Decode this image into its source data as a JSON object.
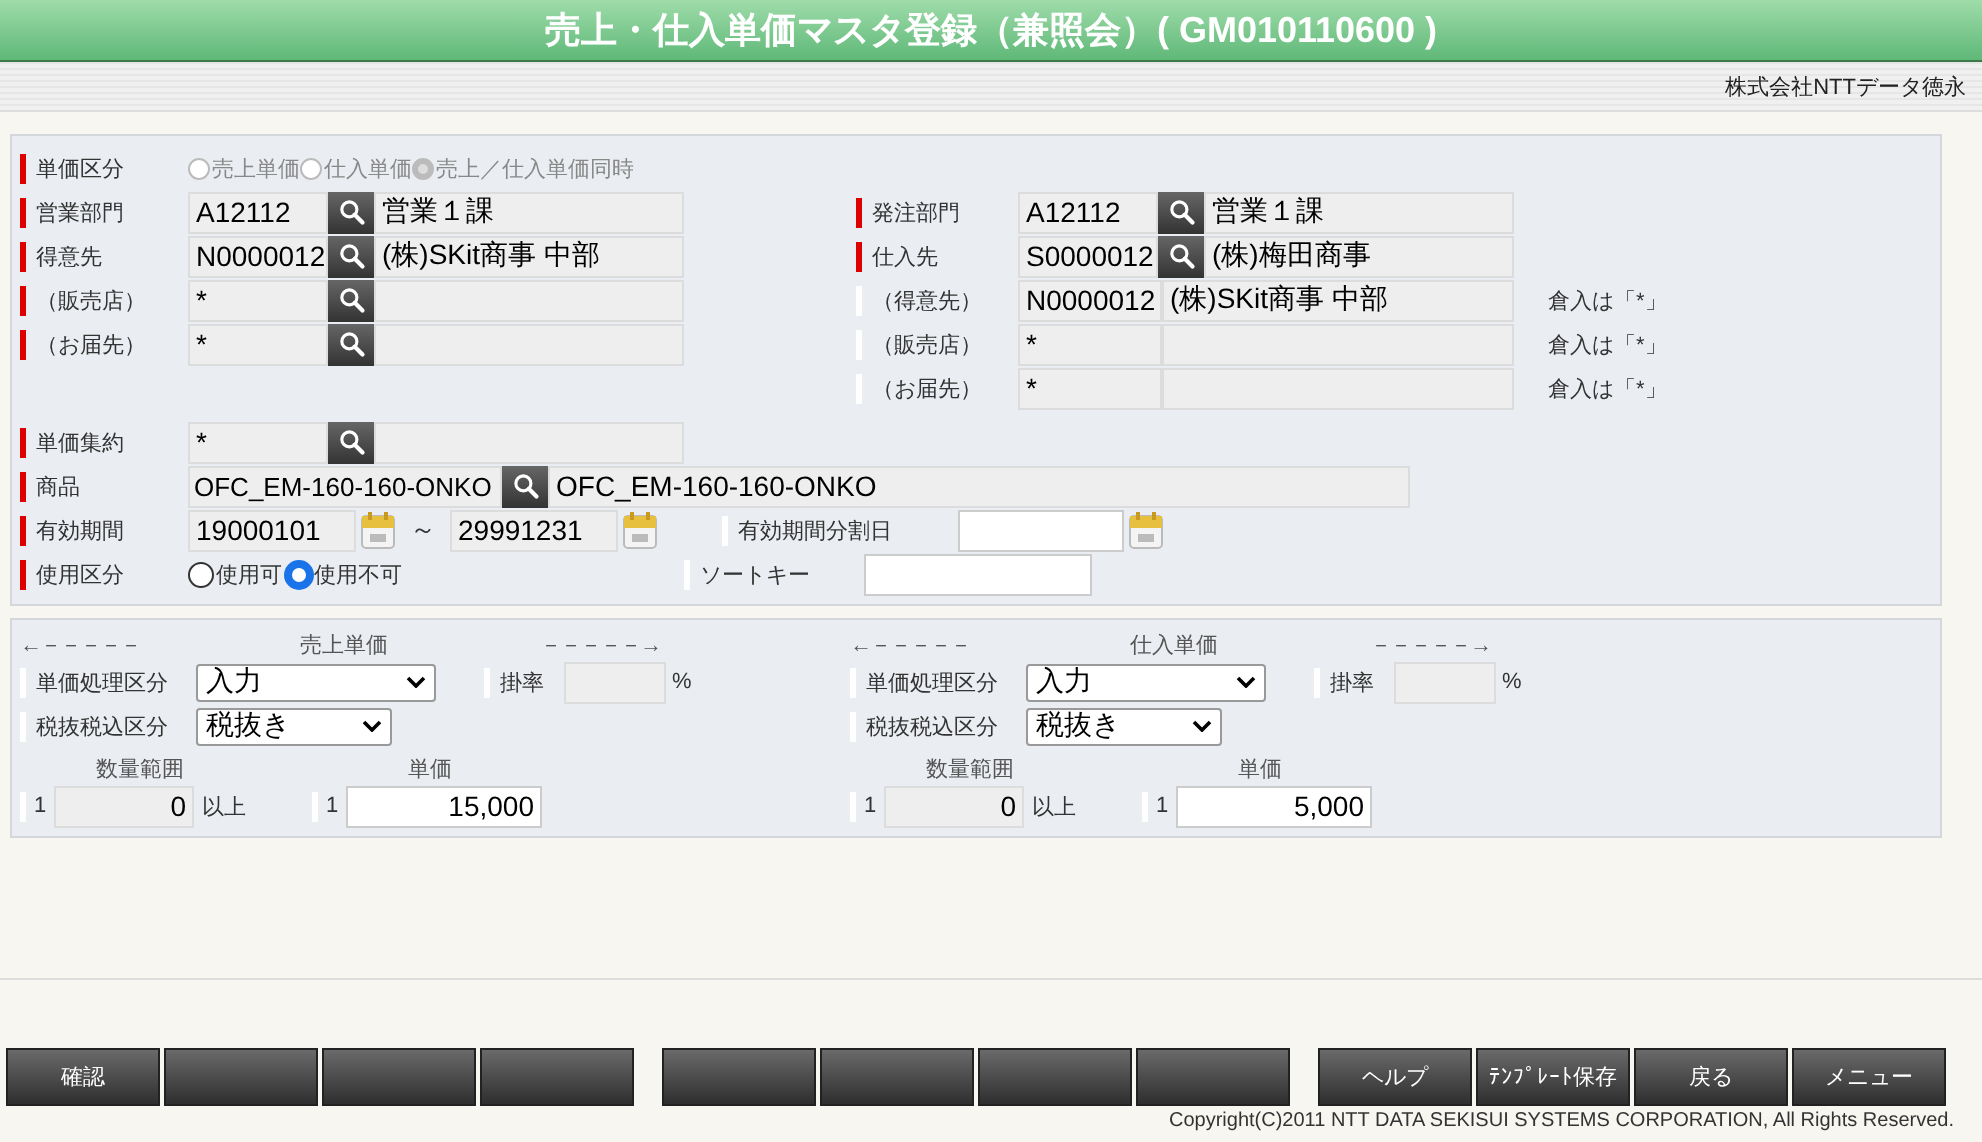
{
  "title": "売上・仕入単価マスタ登録（兼照会）( GM010110600 )",
  "user": "株式会社NTTデータ徳永",
  "price_type": {
    "label": "単価区分",
    "required": true,
    "disabled": true,
    "options": [
      {
        "label": "売上単価",
        "selected": false
      },
      {
        "label": "仕入単価",
        "selected": false
      },
      {
        "label": "売上／仕入単価同時",
        "selected": true
      }
    ]
  },
  "left_fields": [
    {
      "label": "営業部門",
      "required": true,
      "code": "A12112",
      "search": true,
      "name": "営業１課"
    },
    {
      "label": "得意先",
      "required": true,
      "code": "N0000012",
      "search": true,
      "name": "(株)SKit商事 中部"
    },
    {
      "label": "（販売店）",
      "required": true,
      "code": "*",
      "search": true
    },
    {
      "label": "（お届先）",
      "required": true,
      "code": "*",
      "search": true
    }
  ],
  "right_fields": [
    {
      "label": "発注部門",
      "required": true,
      "code": "A12112",
      "search": true,
      "name": "営業１課"
    },
    {
      "label": "仕入先",
      "required": true,
      "code": "S0000012",
      "search": true,
      "name": "(株)梅田商事"
    },
    {
      "label": "（得意先）",
      "required": false,
      "code": "N0000012",
      "search": false,
      "name": "(株)SKit商事 中部",
      "note": "倉入は「*」"
    },
    {
      "label": "（販売店）",
      "required": false,
      "code": "*",
      "search": false,
      "note": "倉入は「*」"
    },
    {
      "label": "（お届先）",
      "required": false,
      "code": "*",
      "search": false,
      "note": "倉入は「*」"
    }
  ],
  "price_group": {
    "label": "単価集約",
    "required": true,
    "code": "*",
    "search": true
  },
  "product": {
    "label": "商品",
    "required": true,
    "code": "OFC_EM-160-160-ONKO",
    "search": true,
    "name": "OFC_EM-160-160-ONKO"
  },
  "valid_period": {
    "label": "有効期間",
    "required": true,
    "from": "19000101",
    "separator": "～",
    "to": "29991231"
  },
  "split_date": {
    "label": "有効期間分割日",
    "required": false
  },
  "usage": {
    "label": "使用区分",
    "required": true,
    "options": [
      {
        "label": "使用可",
        "selected": false
      },
      {
        "label": "使用不可",
        "selected": true
      }
    ]
  },
  "sort_key": {
    "label": "ソートキー",
    "required": false
  },
  "price_sections": [
    {
      "title": "売上単価",
      "left_arrow": "←－－－－－",
      "right_arrow": "－－－－－→",
      "processing": {
        "label": "単価処理区分",
        "required": false,
        "value": "入力"
      },
      "rate": {
        "label": "掛率",
        "required": false,
        "unit": "%"
      },
      "tax": {
        "label": "税抜税込区分",
        "required": false,
        "value": "税抜き"
      },
      "qty_header": "数量範囲",
      "price_header": "単価",
      "tiers": [
        {
          "required": false,
          "qty_index": "1",
          "qty": "0",
          "qty_suffix": "以上",
          "price_index": "1",
          "price": "15,000"
        }
      ]
    },
    {
      "title": "仕入単価",
      "left_arrow": "←－－－－－",
      "right_arrow": "－－－－－→",
      "processing": {
        "label": "単価処理区分",
        "required": false,
        "value": "入力"
      },
      "rate": {
        "label": "掛率",
        "required": false,
        "unit": "%"
      },
      "tax": {
        "label": "税抜税込区分",
        "required": false,
        "value": "税抜き"
      },
      "qty_header": "数量範囲",
      "price_header": "単価",
      "tiers": [
        {
          "required": false,
          "qty_index": "1",
          "qty": "0",
          "qty_suffix": "以上",
          "price_index": "1",
          "price": "5,000"
        }
      ]
    }
  ],
  "button_groups": [
    [
      {
        "kind": "labeled",
        "label": "確認"
      },
      {
        "kind": "blank"
      },
      {
        "kind": "blank"
      },
      {
        "kind": "blank"
      }
    ],
    [
      {
        "kind": "blank"
      },
      {
        "kind": "blank"
      },
      {
        "kind": "blank"
      },
      {
        "kind": "blank"
      }
    ],
    [
      {
        "kind": "labeled",
        "label": "ヘルプ"
      },
      {
        "kind": "labeled",
        "label": "ﾃﾝﾌﾟﾚｰﾄ保存"
      },
      {
        "kind": "labeled",
        "label": "戻る"
      },
      {
        "kind": "labeled",
        "label": "メニュー"
      }
    ]
  ],
  "copyright": "Copyright(C)2011 NTT DATA SEKISUI SYSTEMS CORPORATION, All Rights Reserved."
}
